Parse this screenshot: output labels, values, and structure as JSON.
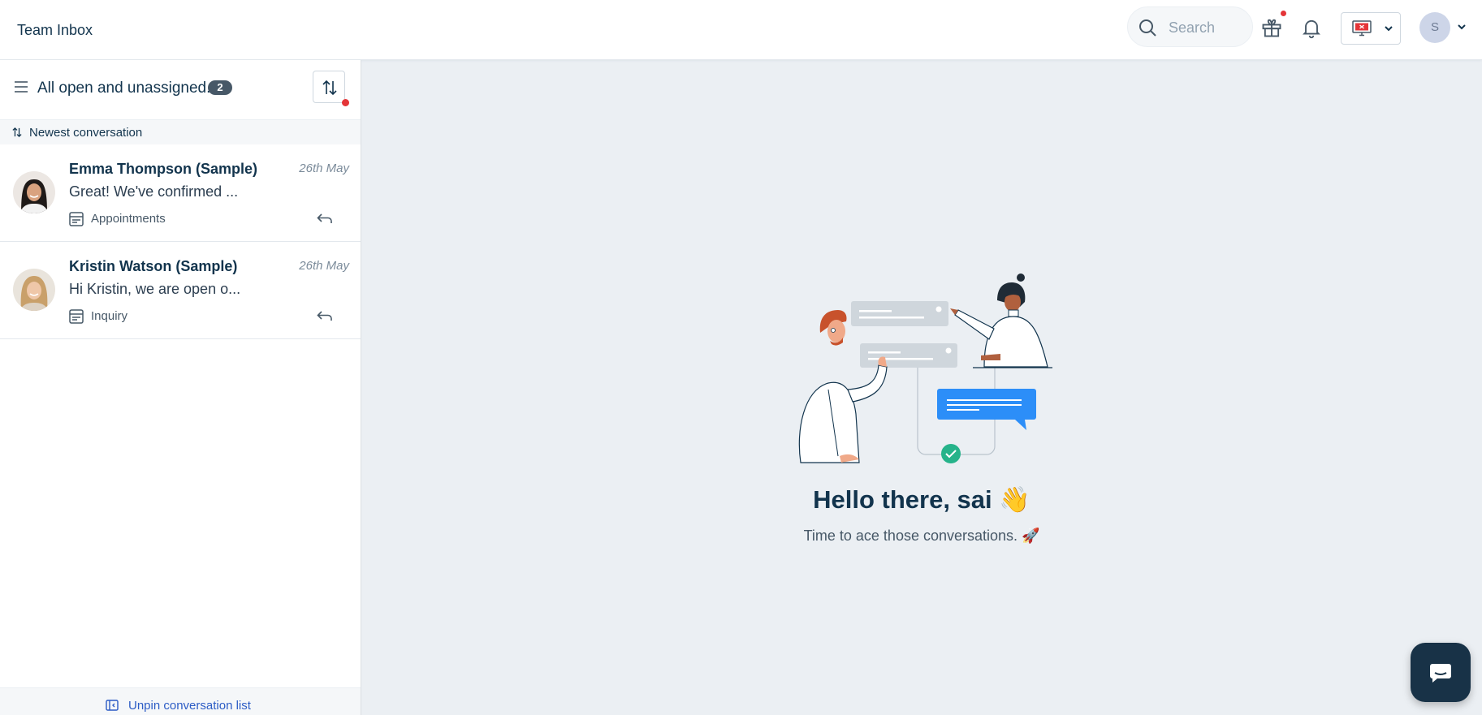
{
  "header": {
    "title": "Team Inbox",
    "search_placeholder": "Search",
    "avatar_initial": "S"
  },
  "conversation_list": {
    "view_title": "All open and unassigned...",
    "count": "2",
    "sort_label": "Newest conversation",
    "items": [
      {
        "name": "Emma Thompson (Sample)",
        "date": "26th May",
        "preview": "Great! We've confirmed ...",
        "inbox": "Appointments"
      },
      {
        "name": "Kristin Watson (Sample)",
        "date": "26th May",
        "preview": "Hi Kristin, we are open o...",
        "inbox": "Inquiry"
      }
    ],
    "unpin_label": "Unpin conversation list"
  },
  "empty_state": {
    "greeting": "Hello there, sai 👋",
    "subtitle": "Time to ace those conversations. 🚀"
  },
  "colors": {
    "primary_text": "#12344d",
    "link_blue": "#2c5cc5",
    "alert_red": "#e43538",
    "chat_fab": "#183247",
    "bubble_blue": "#2c8ef8",
    "check_green": "#26b38a"
  }
}
